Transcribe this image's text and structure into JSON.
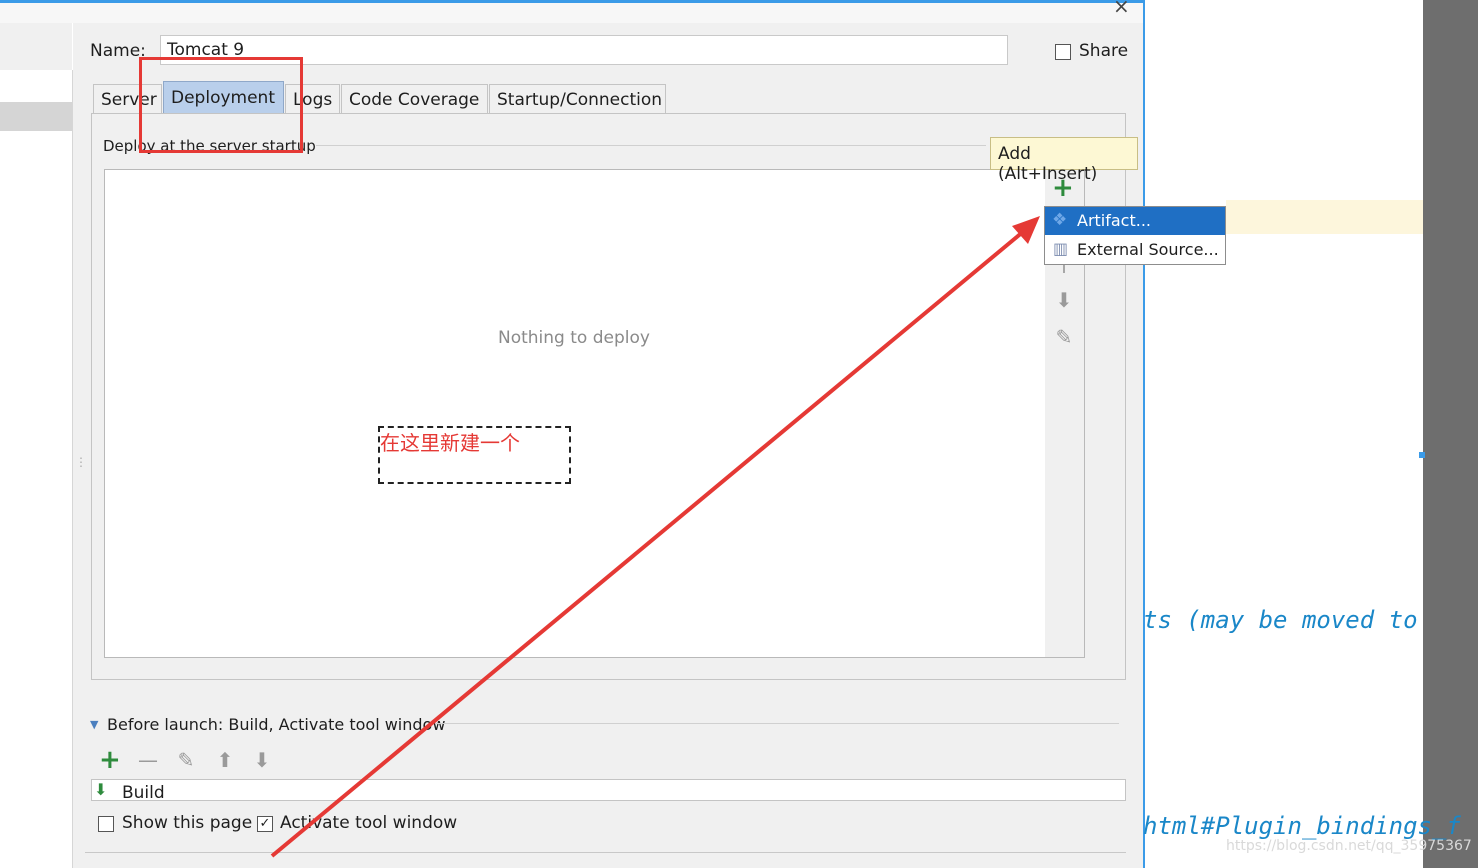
{
  "dialog": {
    "name_label": "Name:",
    "name_value": "Tomcat 9",
    "share_label": "Share",
    "tabs": [
      {
        "label": "Server"
      },
      {
        "label": "Deployment"
      },
      {
        "label": "Logs"
      },
      {
        "label": "Code Coverage"
      },
      {
        "label": "Startup/Connection"
      }
    ],
    "active_tab": "Deployment",
    "deploy_section_label": "Deploy at the server startup",
    "empty_text": "Nothing to deploy",
    "tooltip": "Add (Alt+Insert)",
    "popup_items": [
      {
        "label": "Artifact...",
        "icon": "artifact-icon"
      },
      {
        "label": "External Source...",
        "icon": "external-source-icon"
      }
    ],
    "before_launch_label": "Before launch: Build, Activate tool window",
    "build_item": "Build",
    "show_page_label": "Show this page",
    "activate_tool_label": "Activate tool window",
    "show_page_checked": false,
    "activate_tool_checked": true
  },
  "annotation": {
    "text": "在这里新建一个"
  },
  "editor": {
    "line1": "ts (may be moved to pa",
    "line2": "html#Plugin_bindings_f"
  },
  "watermark": "https://blog.csdn.net/qq_35975367",
  "colors": {
    "accent": "#1f6fc4",
    "annotation_red": "#e53935",
    "code_blue": "#1a87c8",
    "add_green": "#2e8b3d"
  }
}
